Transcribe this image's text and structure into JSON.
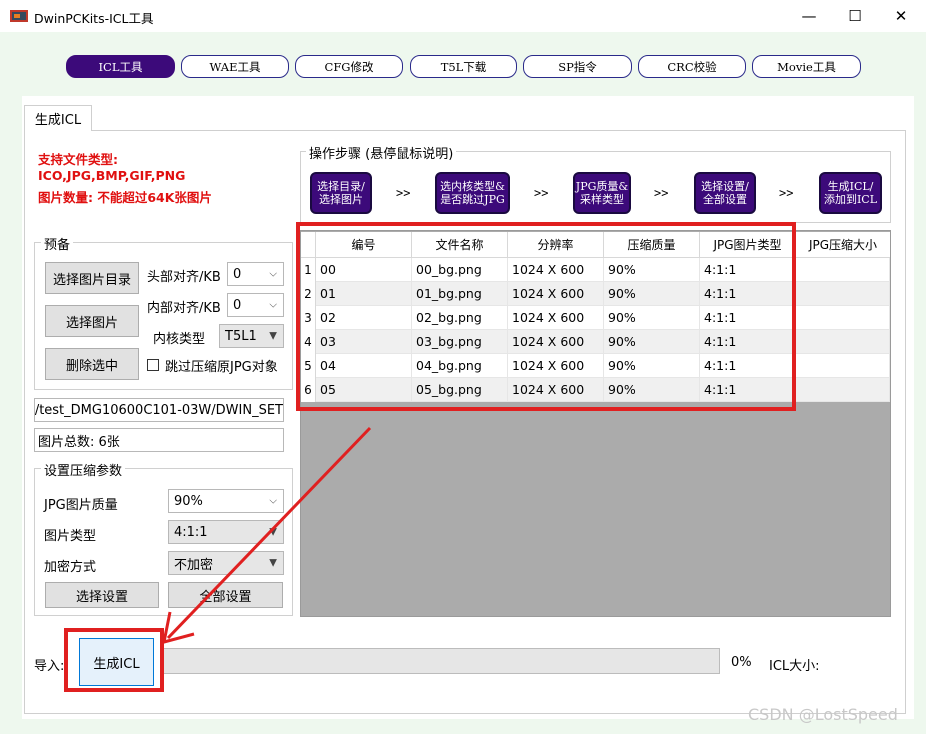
{
  "window": {
    "title": "DwinPCKits-ICL工具",
    "minimize": "—",
    "maximize": "☐",
    "close": "✕"
  },
  "top_tabs": [
    {
      "label": "ICL工具",
      "active": true
    },
    {
      "label": "WAE工具",
      "active": false
    },
    {
      "label": "CFG修改",
      "active": false
    },
    {
      "label": "T5L下载",
      "active": false
    },
    {
      "label": "SP指令",
      "active": false
    },
    {
      "label": "CRC校验",
      "active": false
    },
    {
      "label": "Movie工具",
      "active": false
    }
  ],
  "tab": {
    "label": "生成ICL"
  },
  "notes": {
    "line1": "支持文件类型:",
    "line2": "ICO,JPG,BMP,GIF,PNG",
    "line3": "图片数量: 不能超过64K张图片"
  },
  "prepare": {
    "title": "预备",
    "select_dir": "选择图片目录",
    "select_image": "选择图片",
    "delete_selected": "删除选中",
    "head_align_label": "头部对齐/KB",
    "head_align_value": "0",
    "inner_align_label": "内部对齐/KB",
    "inner_align_value": "0",
    "core_type_label": "内核类型",
    "core_type_value": "T5L1",
    "skip_jpg_label": "跳过压缩原JPG对象"
  },
  "path_value": "/test_DMG10600C101-03W/DWIN_SET",
  "image_count": "图片总数: 6张",
  "compress": {
    "title": "设置压缩参数",
    "jpg_quality_label": "JPG图片质量",
    "jpg_quality_value": "90%",
    "image_type_label": "图片类型",
    "image_type_value": "4:1:1",
    "encrypt_label": "加密方式",
    "encrypt_value": "不加密",
    "apply_selected": "选择设置",
    "apply_all": "全部设置"
  },
  "steps": {
    "title": "操作步骤 (悬停鼠标说明)",
    "items": [
      {
        "line1": "选择目录/",
        "line2": "选择图片"
      },
      {
        "line1": "选内核类型&",
        "line2": "是否跳过JPG"
      },
      {
        "line1": "JPG质量&",
        "line2": "采样类型"
      },
      {
        "line1": "选择设置/",
        "line2": "全部设置"
      },
      {
        "line1": "生成ICL/",
        "line2": "添加到ICL"
      }
    ],
    "arrow": ">>"
  },
  "table": {
    "columns": [
      "编号",
      "文件名称",
      "分辨率",
      "压缩质量",
      "JPG图片类型",
      "JPG压缩大小"
    ],
    "rows": [
      {
        "n": "1",
        "id": "00",
        "file": "00_bg.png",
        "res": "1024 X 600",
        "q": "90%",
        "type": "4:1:1",
        "size": ""
      },
      {
        "n": "2",
        "id": "01",
        "file": "01_bg.png",
        "res": "1024 X 600",
        "q": "90%",
        "type": "4:1:1",
        "size": ""
      },
      {
        "n": "3",
        "id": "02",
        "file": "02_bg.png",
        "res": "1024 X 600",
        "q": "90%",
        "type": "4:1:1",
        "size": ""
      },
      {
        "n": "4",
        "id": "03",
        "file": "03_bg.png",
        "res": "1024 X 600",
        "q": "90%",
        "type": "4:1:1",
        "size": ""
      },
      {
        "n": "5",
        "id": "04",
        "file": "04_bg.png",
        "res": "1024 X 600",
        "q": "90%",
        "type": "4:1:1",
        "size": ""
      },
      {
        "n": "6",
        "id": "05",
        "file": "05_bg.png",
        "res": "1024 X 600",
        "q": "90%",
        "type": "4:1:1",
        "size": ""
      }
    ]
  },
  "bottom": {
    "import_label": "导入:",
    "generate": "生成ICL",
    "progress_text": "0%",
    "progress_fraction": 0,
    "icl_size_label": "ICL大小:"
  },
  "watermark": "CSDN @LostSpeed",
  "colors": {
    "accent_purple": "#3c0a7a",
    "annotation_red": "#e02020",
    "client_green": "#eef8ee"
  }
}
